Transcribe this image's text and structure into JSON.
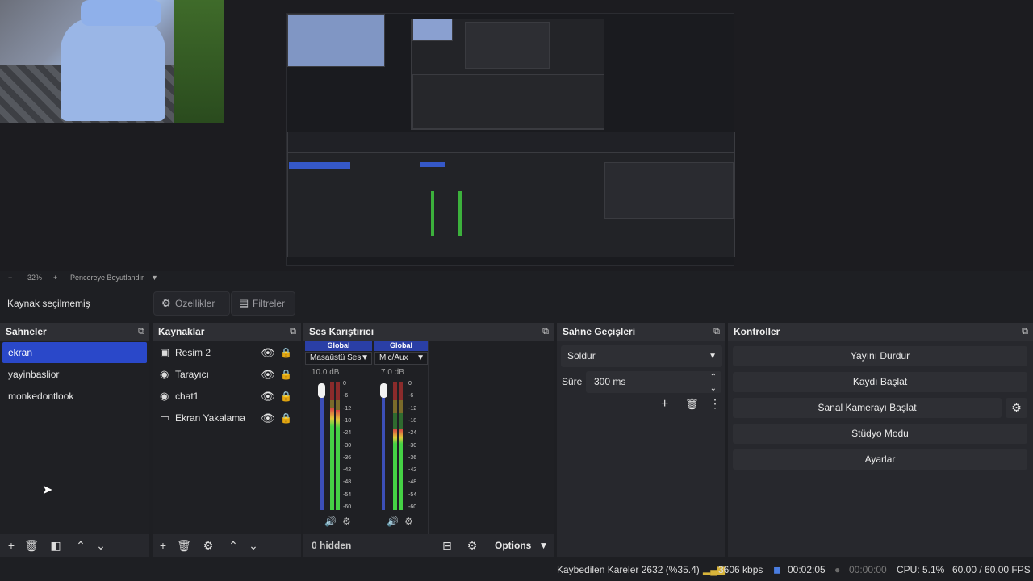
{
  "preview": {
    "zoom": "32%",
    "fit_label": "Pencereye Boyutlandır"
  },
  "context_bar": {
    "selected": "Kaynak seçilmemiş",
    "properties_label": "Özellikler",
    "filters_label": "Filtreler"
  },
  "scenes": {
    "title": "Sahneler",
    "items": [
      "ekran",
      "yayinbaslior",
      "monkedontlook"
    ]
  },
  "sources": {
    "title": "Kaynaklar",
    "items": [
      {
        "name": "Resim 2",
        "icon": "image-icon"
      },
      {
        "name": "Tarayıcı",
        "icon": "globe-icon"
      },
      {
        "name": "chat1",
        "icon": "globe-icon"
      },
      {
        "name": "Ekran Yakalama",
        "icon": "monitor-icon"
      }
    ]
  },
  "mixer": {
    "title": "Ses Karıştırıcı",
    "channels": [
      {
        "head": "Global",
        "name": "Masaüstü Ses",
        "db": "10.0 dB"
      },
      {
        "head": "Global",
        "name": "Mic/Aux",
        "db": "7.0 dB"
      }
    ],
    "ticks": [
      "0",
      "-6",
      "-12",
      "-18",
      "-24",
      "-30",
      "-36",
      "-42",
      "-48",
      "-54",
      "-60"
    ],
    "hidden_label": "0 hidden",
    "options_label": "Options"
  },
  "transitions": {
    "title": "Sahne Geçişleri",
    "selected": "Soldur",
    "duration_label": "Süre",
    "duration_value": "300 ms"
  },
  "controls": {
    "title": "Kontroller",
    "buttons": [
      "Yayını Durdur",
      "Kaydı Başlat",
      "Sanal Kamerayı Başlat",
      "Stüdyo Modu",
      "Ayarlar"
    ]
  },
  "status": {
    "dropped": "Kaybedilen Kareler 2632 (%35.4)",
    "bitrate": "3606 kbps",
    "stream_time": "00:02:05",
    "rec_time": "00:00:00",
    "cpu": "CPU: 5.1%",
    "fps": "60.00 / 60.00 FPS"
  },
  "colors": {
    "accent": "#2a48c9",
    "meter_green": "#45d245",
    "meter_red": "#d74444"
  }
}
